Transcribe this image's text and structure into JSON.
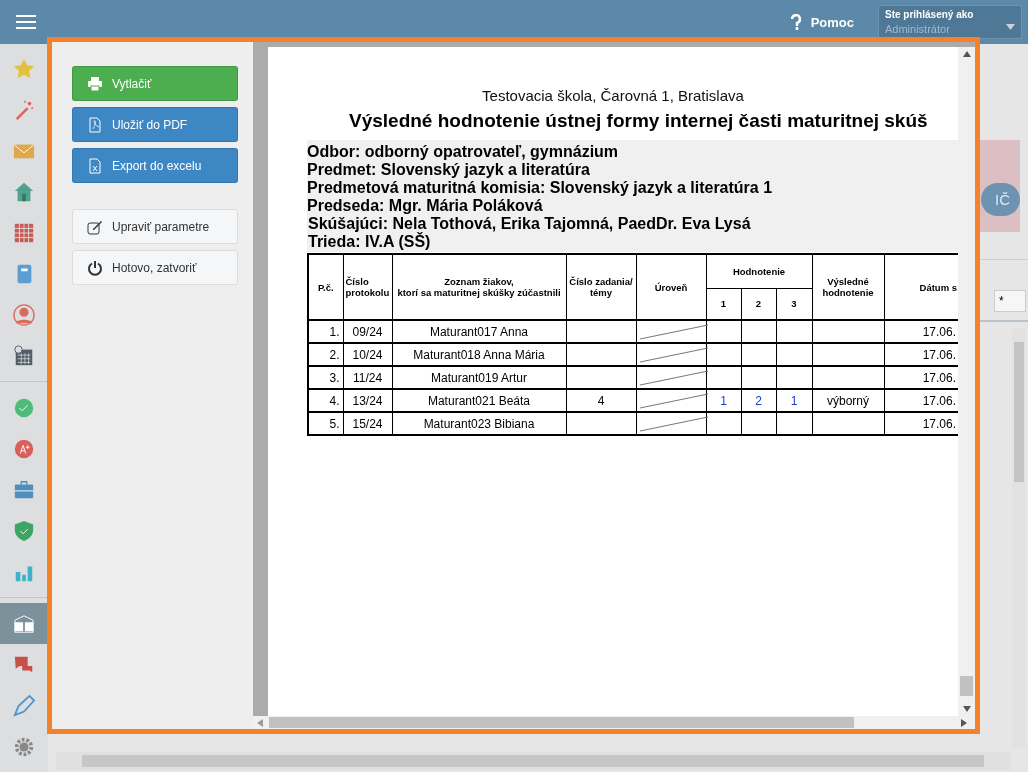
{
  "topbar": {
    "help": "Pomoc",
    "user_caption": "Ste prihlásený ako",
    "user_name": "Administrátor"
  },
  "sidebar": {
    "items": [
      {
        "kind": "star",
        "selected": false
      },
      {
        "kind": "wand",
        "selected": false
      },
      {
        "kind": "mail",
        "selected": false
      },
      {
        "kind": "home",
        "selected": false
      },
      {
        "kind": "grid",
        "selected": false
      },
      {
        "kind": "notebook",
        "selected": false
      },
      {
        "kind": "person",
        "selected": false
      },
      {
        "kind": "calendar",
        "selected": false
      },
      {
        "kind": "divider"
      },
      {
        "kind": "check",
        "selected": false
      },
      {
        "kind": "grade",
        "selected": false
      },
      {
        "kind": "briefcase",
        "selected": false
      },
      {
        "kind": "shield",
        "selected": false
      },
      {
        "kind": "chart",
        "selected": false
      },
      {
        "kind": "divider"
      },
      {
        "kind": "book",
        "selected": true
      },
      {
        "kind": "chat",
        "selected": false
      },
      {
        "kind": "pencil",
        "selected": false
      },
      {
        "kind": "gear",
        "selected": false
      }
    ]
  },
  "background": {
    "badge": "IČ",
    "filter_value": "*"
  },
  "dialog": {
    "actions": [
      {
        "kind": "print",
        "label": "Vytlačiť"
      },
      {
        "kind": "pdf",
        "label": "Uložiť do PDF"
      },
      {
        "kind": "excel",
        "label": "Export do excelu"
      },
      {
        "kind": "edit",
        "label": "Upraviť parametre"
      },
      {
        "kind": "power",
        "label": "Hotovo, zatvoriť"
      }
    ],
    "report": {
      "school": "Testovacia škola, Čarovná 1, Bratislava",
      "title": "Výsledné hodnotenie ústnej formy internej časti maturitnej skúš",
      "info": [
        "Odbor:  odborný opatrovateľ, gymnázium",
        "Predmet: Slovenský jazyk a literatúra",
        "Predmetová maturitná komisia: Slovenský jazyk a literatúra 1",
        "Predseda: Mgr. Mária Poláková",
        "Skúšajúci:  Nela Tothová, Erika Tajomná, PaedDr. Eva Lysá",
        "Trieda: IV.A (SŠ)"
      ],
      "table": {
        "columns": {
          "number": "P.č.",
          "protocol": "Číslo protokolu",
          "students": "Zoznam žiakov,\nktorí sa maturitnej skúšky zúčastnili",
          "assignment": "Číslo zadania/ témy",
          "level": "Úroveň",
          "grading": "Hodnotenie",
          "grading_parts": [
            "1",
            "2",
            "3"
          ],
          "final": "Výsledné hodnotenie",
          "date": "Dátum s"
        },
        "rows": [
          {
            "number": "1.",
            "protocol": "09/24",
            "student": "Maturant017 Anna",
            "date": "17.06."
          },
          {
            "number": "2.",
            "protocol": "10/24",
            "student": "Maturant018 Anna Mária",
            "date": "17.06."
          },
          {
            "number": "3.",
            "protocol": "11/24",
            "student": "Maturant019 Artur",
            "date": "17.06."
          },
          {
            "number": "4.",
            "protocol": "13/24",
            "student": "Maturant021 Beáta",
            "assignment": "4",
            "grades": [
              "1",
              "2",
              "1"
            ],
            "final": "výborný",
            "date": "17.06."
          },
          {
            "number": "5.",
            "protocol": "15/24",
            "student": "Maturant023 Bibiana",
            "date": "17.06."
          }
        ]
      }
    }
  }
}
